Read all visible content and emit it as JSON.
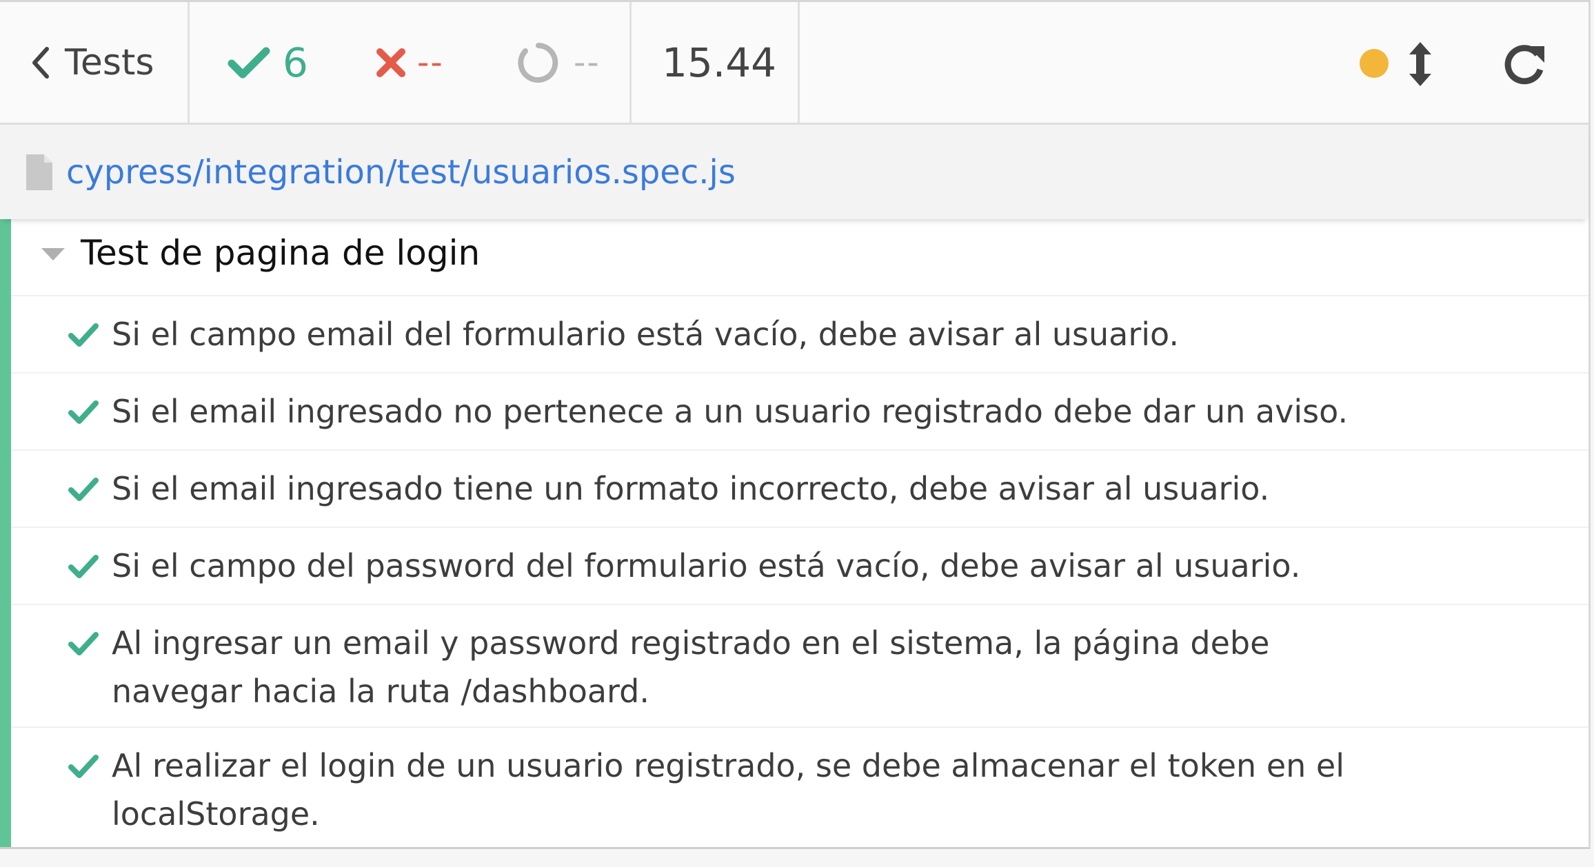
{
  "header": {
    "back_label": "Tests",
    "passed_count": "6",
    "failed_count": "--",
    "pending_count": "--",
    "duration": "15.44"
  },
  "spec": {
    "path": "cypress/integration/test/usuarios.spec.js"
  },
  "suite": {
    "title": "Test de pagina de login",
    "tests": [
      {
        "title": "Si el campo email del formulario está vacío, debe avisar al usuario.",
        "state": "passed"
      },
      {
        "title": "Si el email ingresado no pertenece a un usuario registrado debe dar un aviso.",
        "state": "passed"
      },
      {
        "title": "Si el email ingresado tiene un formato incorrecto, debe avisar al usuario.",
        "state": "passed"
      },
      {
        "title": "Si el campo del password del formulario está vacío, debe avisar al usuario.",
        "state": "passed"
      },
      {
        "title": "Al ingresar un email y password registrado en el sistema, la página debe navegar hacia la ruta /dashboard.",
        "state": "passed"
      },
      {
        "title": "Al realizar el login de un usuario registrado, se debe almacenar el token en el localStorage.",
        "state": "passed"
      }
    ]
  },
  "colors": {
    "passed": "#3fae8d",
    "failed": "#e55b4a",
    "pending": "#b6b6b6",
    "running_dot": "#f2b63b",
    "link": "#3a7bdb",
    "suite_bar": "#5fc596"
  },
  "icons": {
    "back": "chevron-left-icon",
    "passed": "check-icon",
    "failed": "x-icon",
    "pending": "circle-notch-icon",
    "running": "dot-icon",
    "resize": "arrows-v-icon",
    "reload": "reload-icon",
    "file": "file-icon",
    "collapse": "caret-down-icon"
  }
}
